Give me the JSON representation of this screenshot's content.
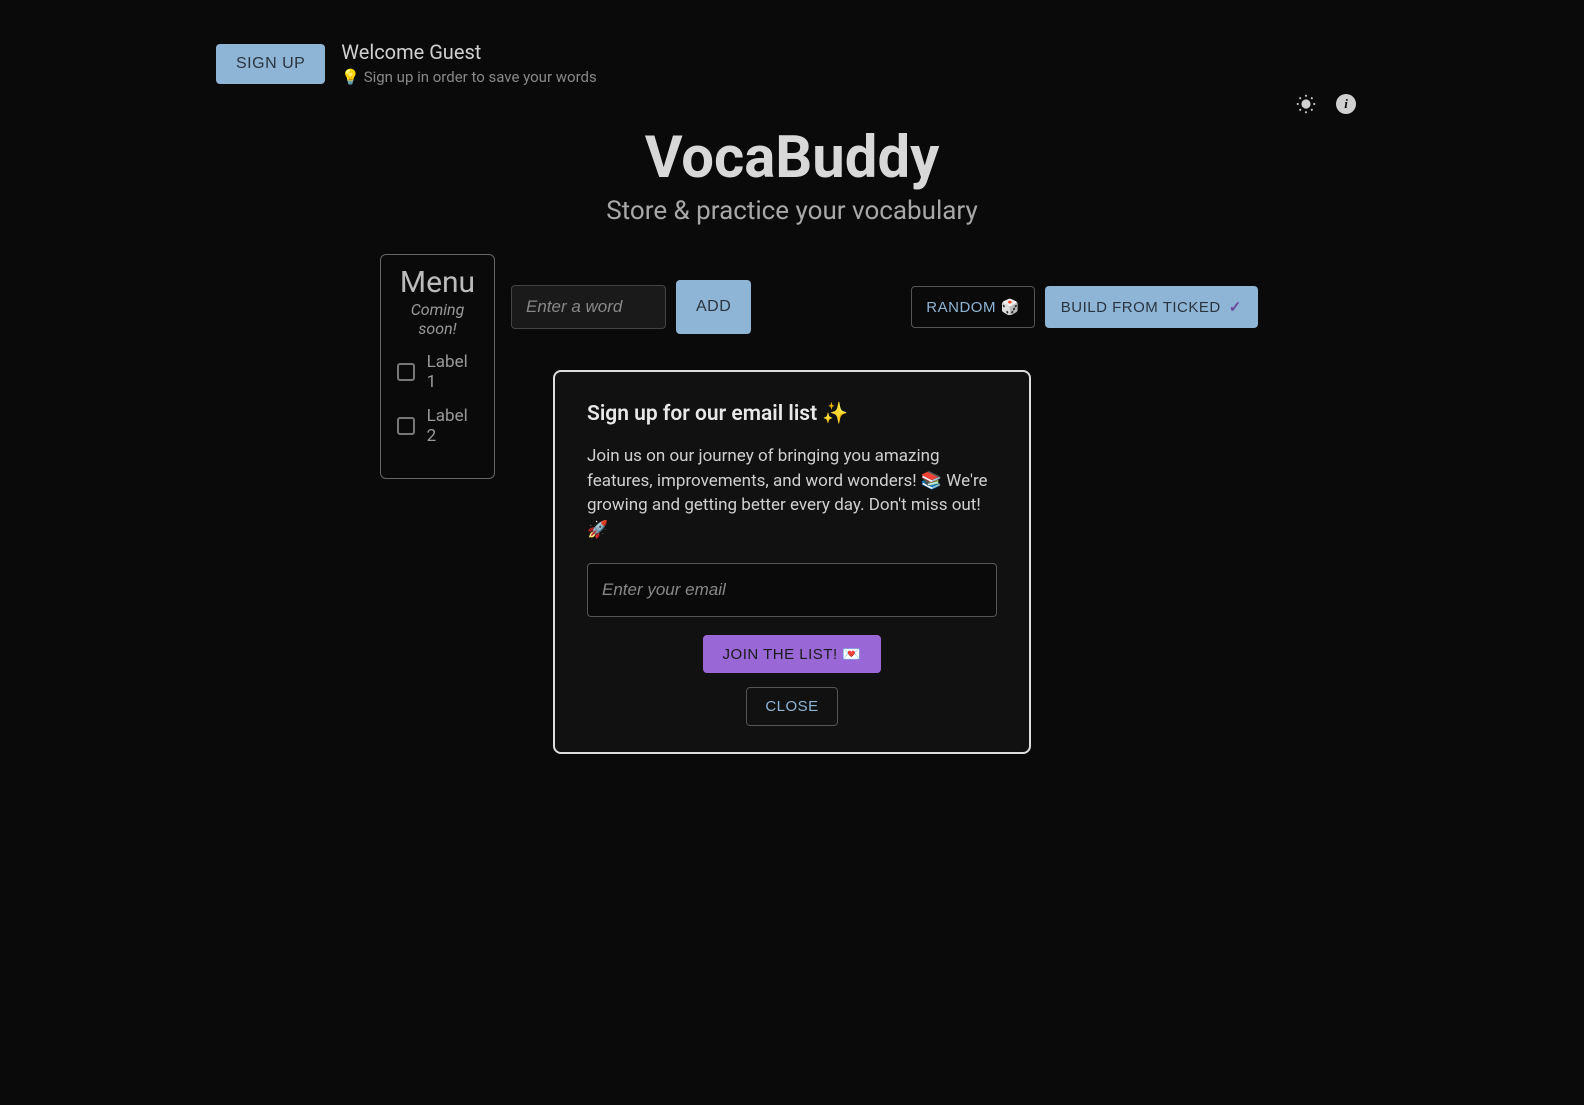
{
  "header": {
    "signup_label": "SIGN UP",
    "welcome": "Welcome Guest",
    "hint": "💡 Sign up in order to save your words"
  },
  "title": {
    "main": "VocaBuddy",
    "sub": "Store & practice your vocabulary"
  },
  "menu": {
    "title": "Menu",
    "subtitle": "Coming soon!",
    "items": [
      {
        "label": "Label 1"
      },
      {
        "label": "Label 2"
      }
    ]
  },
  "controls": {
    "word_placeholder": "Enter a word",
    "add_label": "ADD",
    "random_label": "RANDOM 🎲",
    "build_label": "BUILD FROM TICKED"
  },
  "modal": {
    "title": "Sign up for our email list ✨",
    "body": "Join us on our journey of bringing you amazing features, improvements, and word wonders! 📚 We're growing and getting better every day. Don't miss out! 🚀",
    "email_placeholder": "Enter your email",
    "join_label": "JOIN THE LIST! 💌",
    "close_label": "CLOSE"
  }
}
